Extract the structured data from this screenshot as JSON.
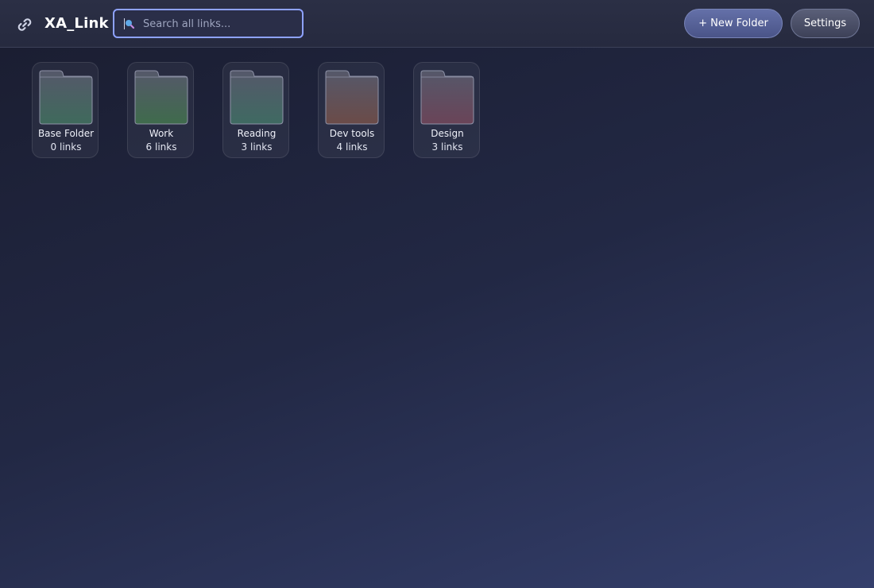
{
  "app": {
    "title": "XA_Link",
    "logo_icon": "link-icon"
  },
  "search": {
    "placeholder": "Search all links...",
    "value": "",
    "icon": "search-icon",
    "accent": "#8ea2ff"
  },
  "toolbar": {
    "new_folder_label": "+ New Folder",
    "settings_label": "Settings"
  },
  "folders": [
    {
      "name": "Base Folder",
      "count": "0 links",
      "tint": "#3f6a5c"
    },
    {
      "name": "Work",
      "count": "6 links",
      "tint": "#3f6b4c"
    },
    {
      "name": "Reading",
      "count": "3 links",
      "tint": "#3f6a62"
    },
    {
      "name": "Dev tools",
      "count": "4 links",
      "tint": "#6b4b48"
    },
    {
      "name": "Design",
      "count": "3 links",
      "tint": "#6a4458"
    }
  ]
}
